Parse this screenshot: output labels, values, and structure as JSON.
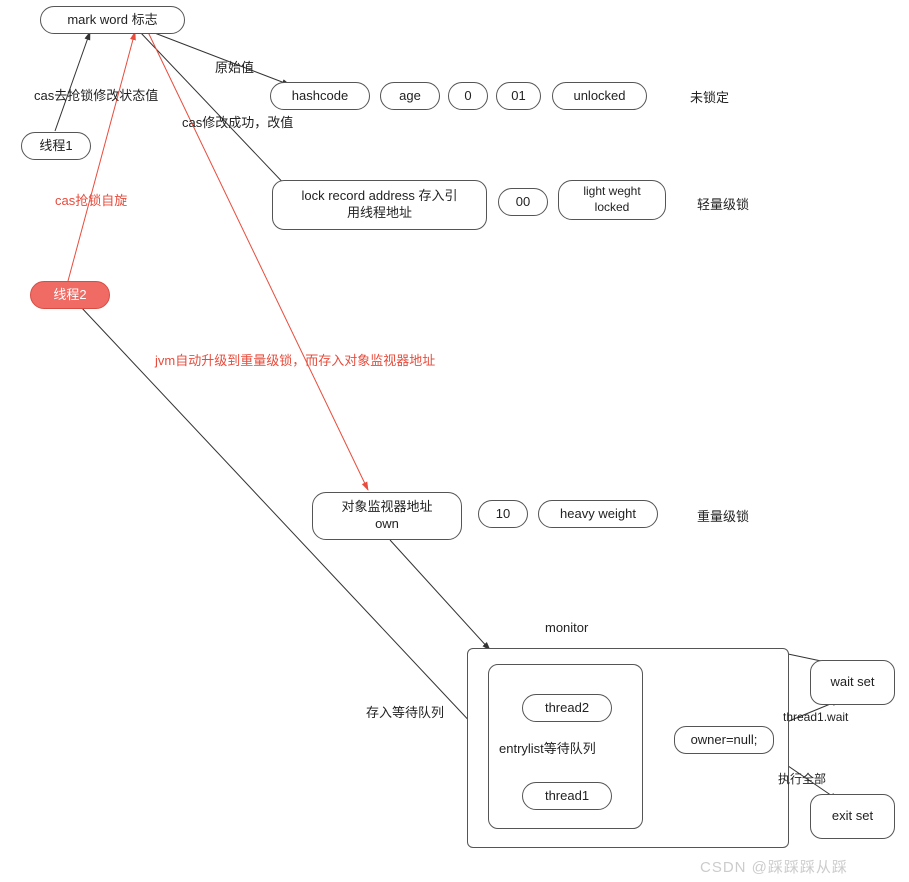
{
  "nodes": {
    "markword": "mark word 标志",
    "thread1": "线程1",
    "thread2": "线程2",
    "hashcode": "hashcode",
    "age": "age",
    "zero": "0",
    "zo": "01",
    "unlocked": "unlocked",
    "unlocked_label": "未锁定",
    "lockrec": "lock record address 存入引\n用线程地址",
    "lr_00": "00",
    "lr_lw": "light weght\nlocked",
    "light_label": "轻量级锁",
    "mon_addr": "对象监视器地址\nown",
    "mon_10": "10",
    "mon_hw": "heavy weight",
    "heavy_label": "重量级锁",
    "monitor_label": "monitor",
    "entry": "entrylist等待队列",
    "th2": "thread2",
    "th1": "thread1",
    "owner": "owner=null;",
    "waitset": "wait set",
    "exitset": "exit set"
  },
  "edge_labels": {
    "e1": "cas去抢锁修改状态值",
    "e2": "原始值",
    "e3": "cas修改成功，改值",
    "e4": "cas抢锁自旋",
    "e5": "jvm自动升级到重量级锁，而存入对象监视器地址",
    "e6": "存入等待队列",
    "e7": "thread1.wait",
    "e8": "执行全部"
  },
  "watermark": "CSDN @踩踩踩从踩"
}
